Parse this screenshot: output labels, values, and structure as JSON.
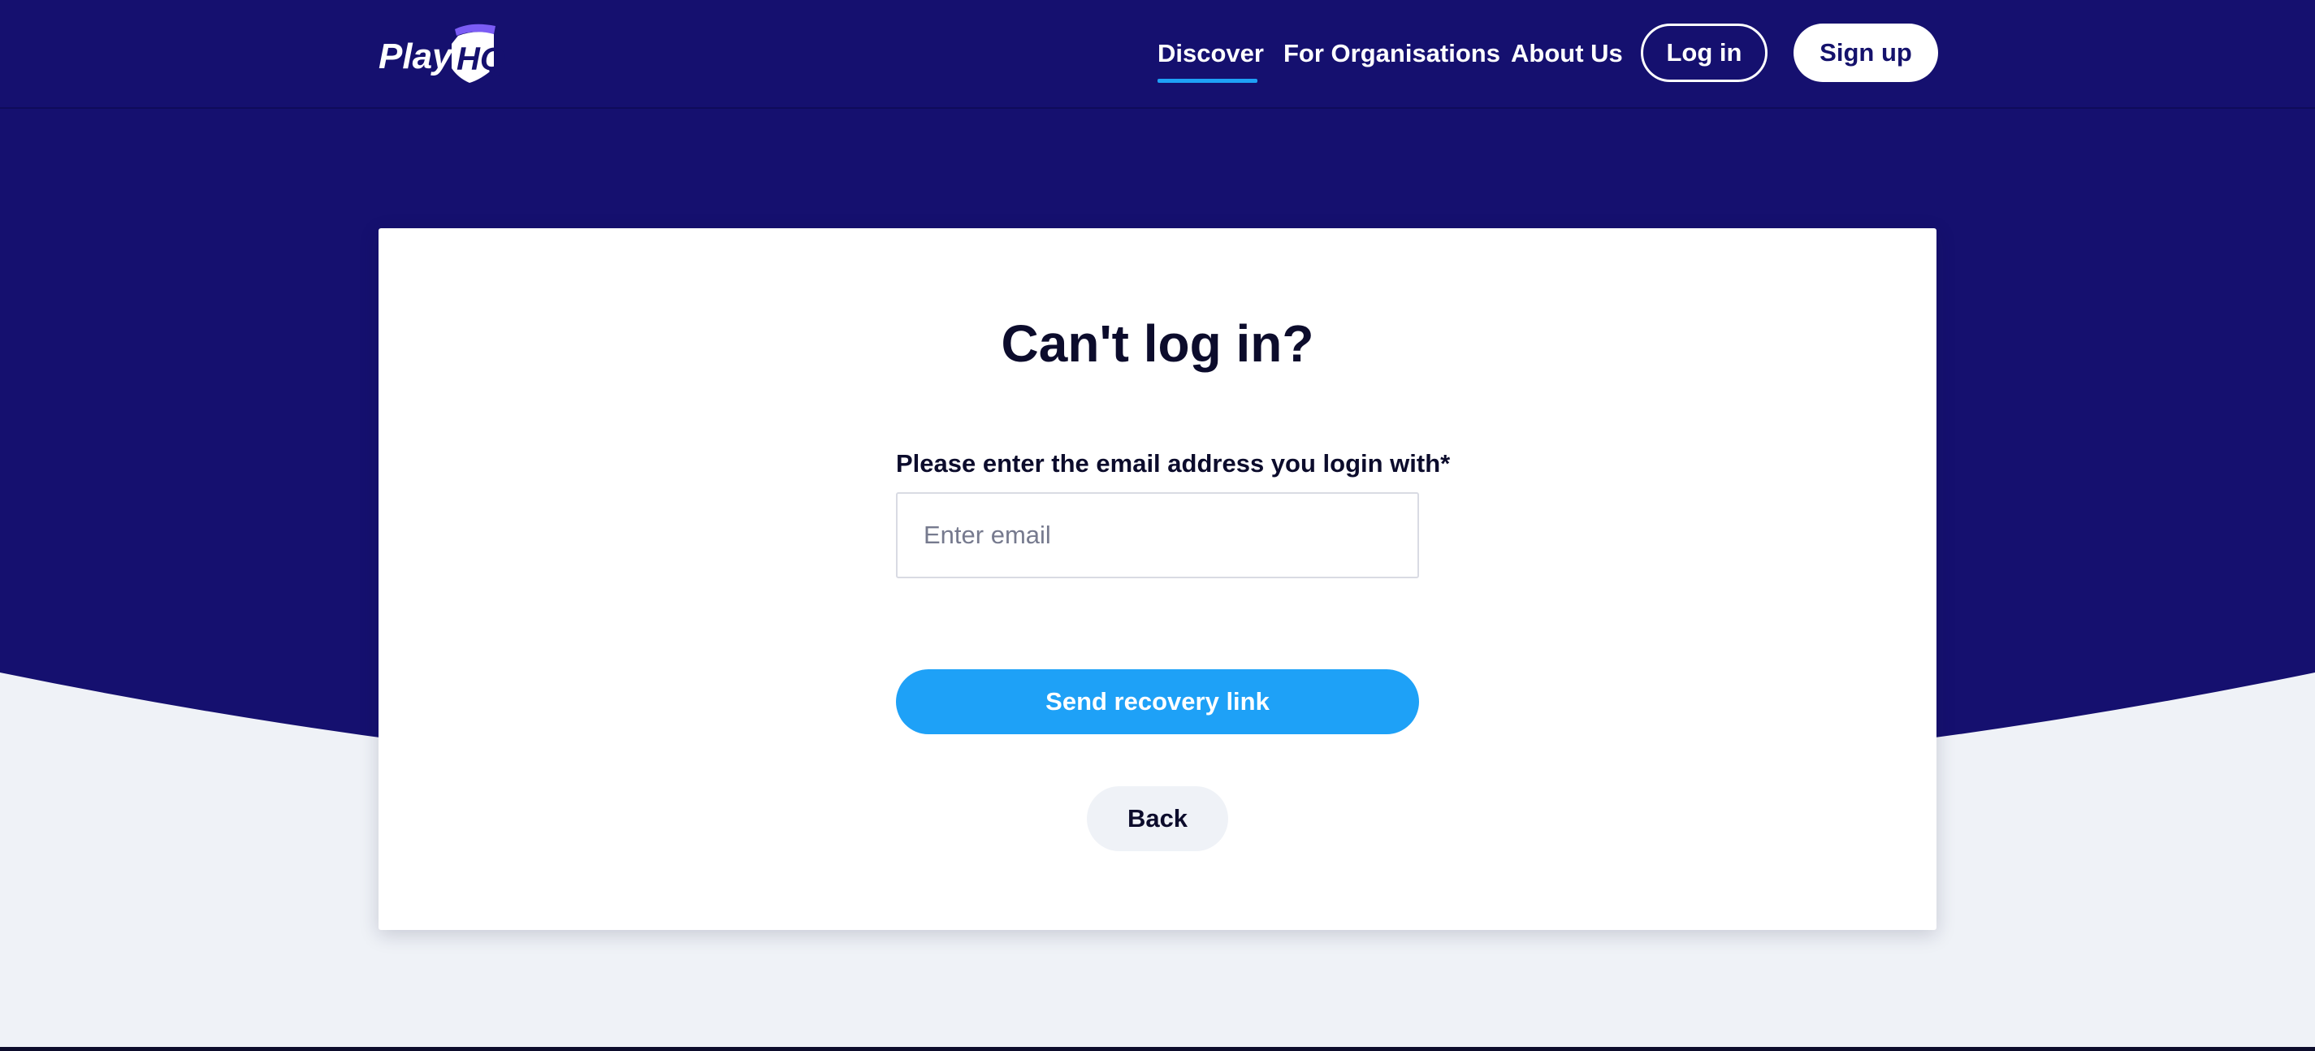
{
  "brand": {
    "logo_text": "PlayHQ",
    "primary_color": "#15106f",
    "accent_color": "#1ea1f7",
    "background_color": "#eff2f7"
  },
  "nav": {
    "items": [
      {
        "label": "Discover",
        "active": true
      },
      {
        "label": "For Organisations",
        "active": false
      },
      {
        "label": "About Us",
        "active": false
      }
    ],
    "login_label": "Log in",
    "signup_label": "Sign up"
  },
  "recovery": {
    "title": "Can't log in?",
    "email_label": "Please enter the email address you login with*",
    "email_value": "",
    "email_placeholder": "Enter email",
    "send_label": "Send recovery link",
    "back_label": "Back"
  }
}
